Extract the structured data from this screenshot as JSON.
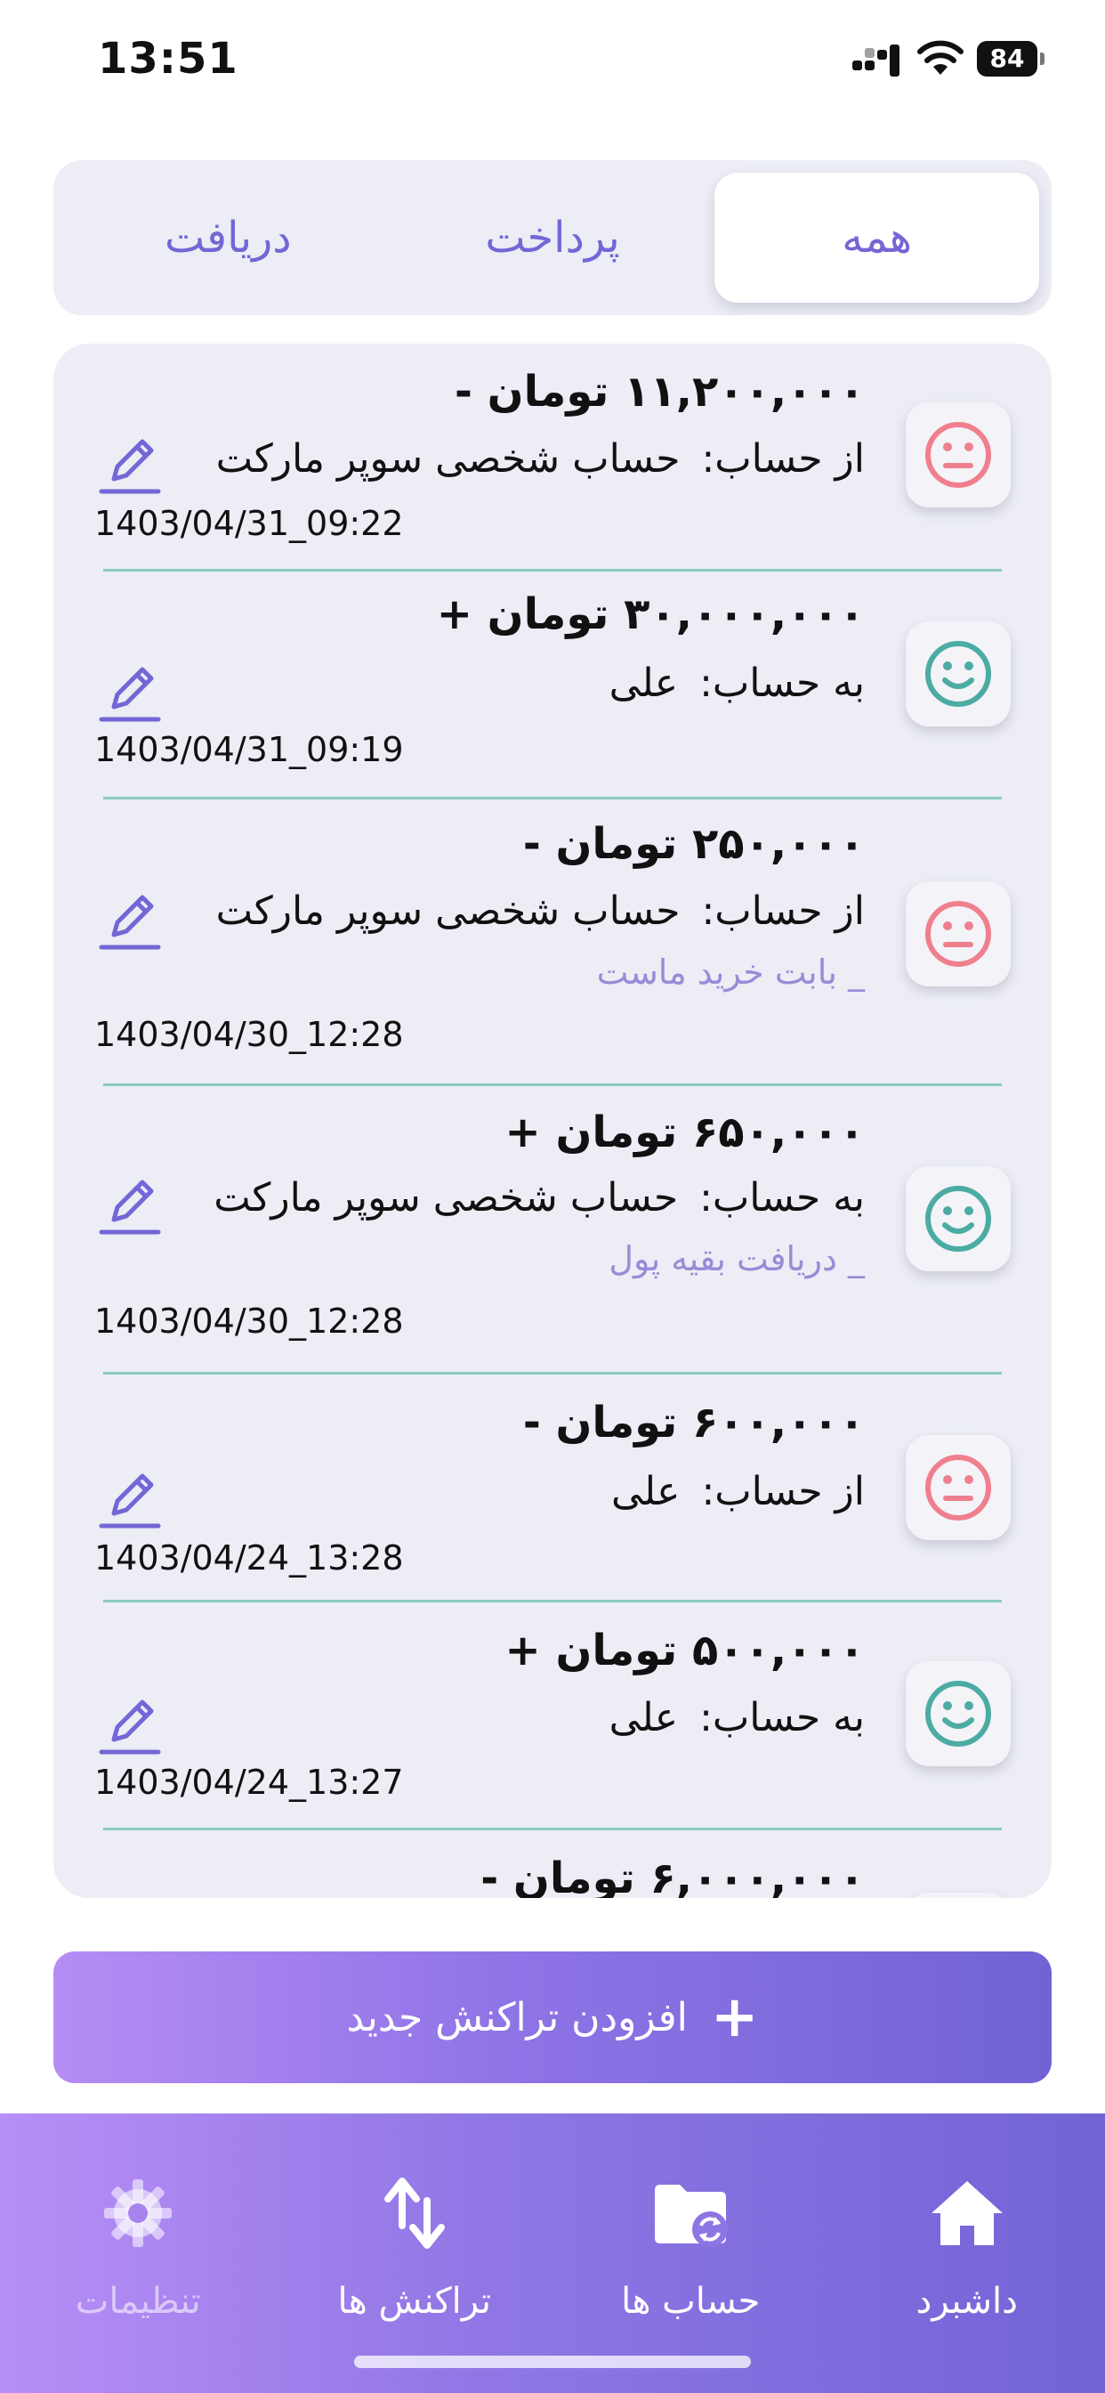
{
  "status_bar": {
    "time": "13:51",
    "battery": "84"
  },
  "tabs": [
    {
      "label": "همه",
      "active": true
    },
    {
      "label": "پرداخت",
      "active": false
    },
    {
      "label": "دریافت",
      "active": false
    }
  ],
  "transactions": [
    {
      "amount": "۱۱,۲۰۰,۰۰۰ تومان -",
      "account_prefix": "از حساب:",
      "account": "حساب شخصی سوپر مارکت",
      "note": "",
      "date": "1403/04/31_09:22",
      "type": "expense",
      "icon": "sad-face-icon"
    },
    {
      "amount": "۳۰,۰۰۰,۰۰۰ تومان +",
      "account_prefix": "به حساب:",
      "account": "علی",
      "note": "",
      "date": "1403/04/31_09:19",
      "type": "income",
      "icon": "smile-face-icon"
    },
    {
      "amount": "۲۵۰,۰۰۰ تومان -",
      "account_prefix": "از حساب:",
      "account": "حساب شخصی سوپر مارکت",
      "note": "_ بابت خرید ماست",
      "date": "1403/04/30_12:28",
      "type": "expense",
      "icon": "sad-face-icon"
    },
    {
      "amount": "۶۵۰,۰۰۰ تومان +",
      "account_prefix": "به حساب:",
      "account": "حساب شخصی سوپر مارکت",
      "note": "_ دریافت بقیه پول",
      "date": "1403/04/30_12:28",
      "type": "income",
      "icon": "smile-face-icon"
    },
    {
      "amount": "۶۰۰,۰۰۰ تومان -",
      "account_prefix": "از حساب:",
      "account": "علی",
      "note": "",
      "date": "1403/04/24_13:28",
      "type": "expense",
      "icon": "sad-face-icon"
    },
    {
      "amount": "۵۰۰,۰۰۰ تومان +",
      "account_prefix": "به حساب:",
      "account": "علی",
      "note": "",
      "date": "1403/04/24_13:27",
      "type": "income",
      "icon": "smile-face-icon"
    },
    {
      "amount": "۶,۰۰۰,۰۰۰ تومان -",
      "account_prefix": "",
      "account": "",
      "note": "",
      "date": "",
      "type": "expense",
      "icon": "sad-face-icon"
    }
  ],
  "add_button": {
    "label": "افزودن تراکنش جدید"
  },
  "bottom_nav": [
    {
      "label": "داشبرد",
      "icon": "home-icon"
    },
    {
      "label": "حساب ها",
      "icon": "folder-sync-icon"
    },
    {
      "label": "تراکنش ها",
      "icon": "transfer-arrows-icon"
    },
    {
      "label": "تنظیمات",
      "icon": "gear-icon"
    }
  ],
  "colors": {
    "accent": "#7466d6",
    "expense": "#f07f8e",
    "income": "#4caba3",
    "divider": "#8cc9c3",
    "card_bg": "#ecedf5"
  }
}
